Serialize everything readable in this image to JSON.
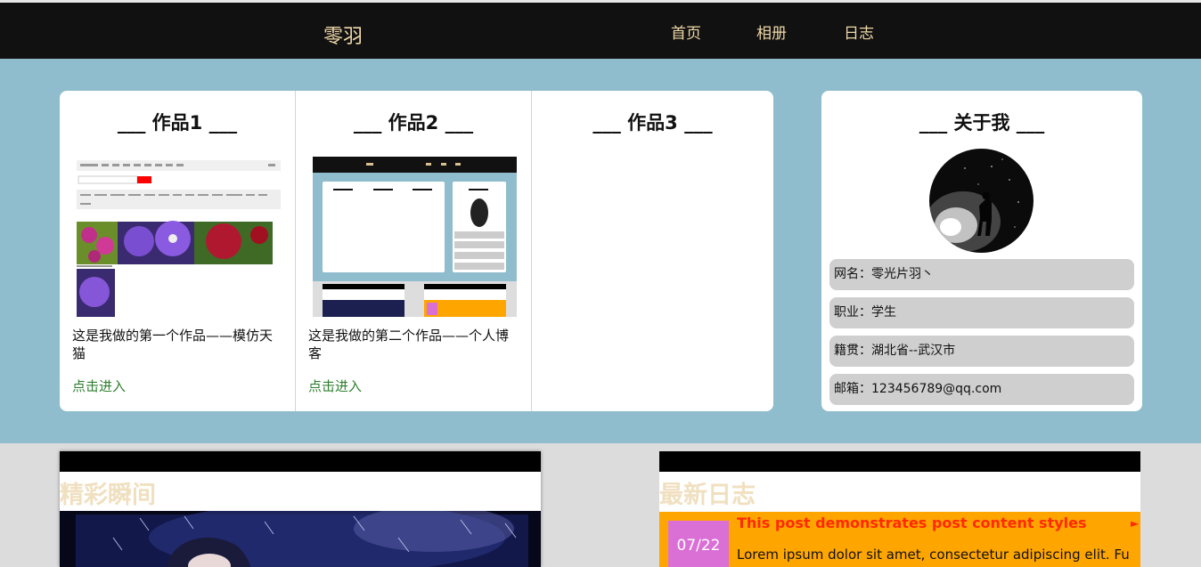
{
  "header": {
    "logo": "零羽",
    "nav": [
      "首页",
      "相册",
      "日志"
    ]
  },
  "works": [
    {
      "title": "___ 作品1 ___",
      "desc": "这是我做的第一个作品——模仿天猫",
      "link": "点击进入"
    },
    {
      "title": "___ 作品2 ___",
      "desc": "这是我做的第二个作品——个人博客",
      "link": "点击进入"
    },
    {
      "title": "___ 作品3 ___"
    }
  ],
  "about": {
    "title": "___ 关于我 ___",
    "rows": [
      "网名：零光片羽丶",
      "职业：学生",
      "籍贯：湖北省--武汉市",
      "邮箱：123456789@qq.com"
    ]
  },
  "moments": {
    "title": "精彩瞬间"
  },
  "journal": {
    "title": "最新日志",
    "post": {
      "date": "07/22",
      "title": "This post demonstrates post content styles",
      "arrow": "►",
      "text": "Lorem ipsum dolor sit amet, consectetur adipiscing elit. Fusce bibendum"
    }
  },
  "colors": {
    "header_bg": "#111111",
    "accent_text": "#f0d8a8",
    "band_bg": "#8fbdcd",
    "link": "#2f7f2f",
    "post_bg": "#ffa500",
    "post_date_bg": "#da70d6",
    "post_title": "#ff2a00"
  }
}
